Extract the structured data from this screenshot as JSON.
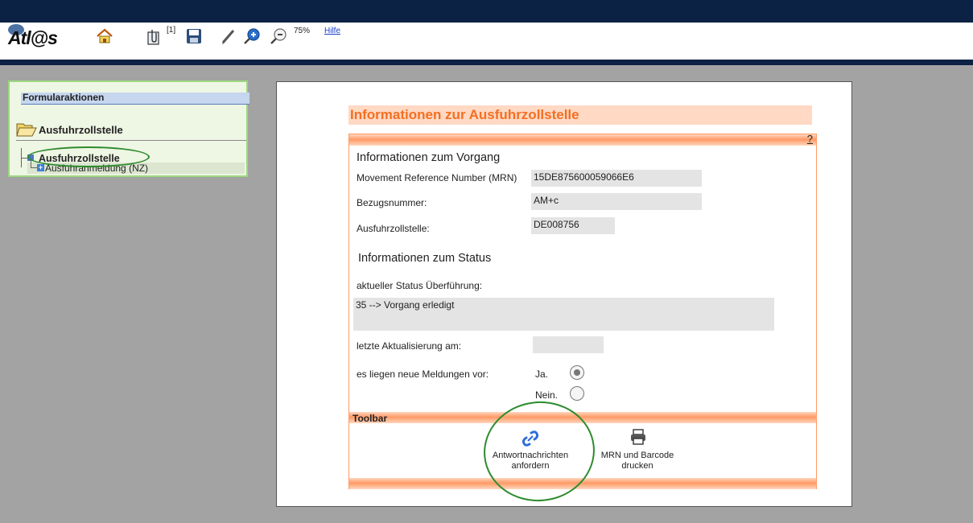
{
  "app": {
    "logo_text": "Atl@s",
    "zoom_level": "75%",
    "help_link": "Hilfe",
    "attachment_count": "[1]"
  },
  "colors": {
    "navy": "#0b2244",
    "accent_orange": "#f36f22",
    "frame_orange": "#ff9a66",
    "sidebar_green": "#9dd77f",
    "highlight_green": "#2e8b2e",
    "background_gray": "#a3a3a3"
  },
  "sidebar": {
    "title": "Formularaktionen",
    "section": "Ausfuhrzollstelle",
    "tree": [
      {
        "label": "Ausfuhrzollstelle",
        "icon": "collapse-icon"
      },
      {
        "label": "Ausfuhranmeldung (NZ)",
        "icon": "expand-icon"
      }
    ]
  },
  "form": {
    "title": "Informationen zur Ausfuhrzollstelle",
    "help": "?",
    "vorgang": {
      "heading": "Informationen zum Vorgang",
      "mrn_label": "Movement Reference Number (MRN)",
      "mrn_value": "15DE875600059066E6",
      "bezug_label": "Bezugsnummer:",
      "bezug_value": "AM+c",
      "zollstelle_label": "Ausfuhrzollstelle:",
      "zollstelle_value": "DE008756"
    },
    "status": {
      "heading": "Informationen zum Status",
      "status_label": "aktueller Status Überführung:",
      "status_value": "35 --> Vorgang erledigt",
      "update_label": "letzte Aktualisierung am:",
      "update_value": "",
      "messages_label": "es liegen neue Meldungen vor:",
      "option_yes": "Ja.",
      "option_no": "Nein.",
      "selected": "yes"
    },
    "toolbar": {
      "label": "Toolbar",
      "request_line1": "Antwortnachrichten",
      "request_line2": "anfordern",
      "print_line1": "MRN und Barcode",
      "print_line2": "drucken"
    }
  }
}
